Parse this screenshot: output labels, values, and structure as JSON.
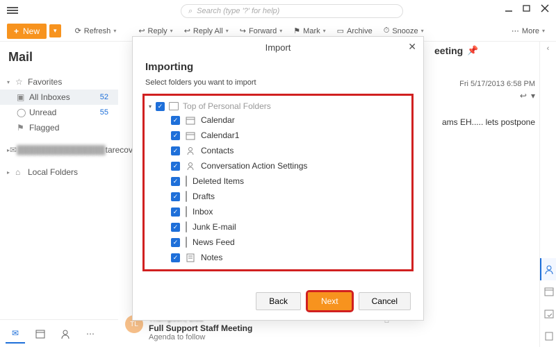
{
  "search": {
    "placeholder": "Search (type '?' for help)"
  },
  "toolbar": {
    "new": "New",
    "refresh": "Refresh",
    "reply": "Reply",
    "reply_all": "Reply All",
    "forward": "Forward",
    "mark": "Mark",
    "archive": "Archive",
    "snooze": "Snooze",
    "more": "More"
  },
  "sidebar": {
    "title": "Mail",
    "favorites": "Favorites",
    "items": [
      {
        "label": "All Inboxes",
        "count": "52"
      },
      {
        "label": "Unread",
        "count": "55"
      },
      {
        "label": "Flagged",
        "count": ""
      }
    ],
    "account_blur": "tarecovery",
    "local": "Local Folders"
  },
  "list": {
    "avatar_initials": "TL",
    "from": "Thompson, Lisa",
    "subject": "Full Support Staff Meeting",
    "preview": "Agenda to follow"
  },
  "preview": {
    "subject": "eeting",
    "date": "Fri 5/17/2013 6:58 PM",
    "body": "ams EH..... lets postpone"
  },
  "dialog": {
    "title": "Import",
    "heading": "Importing",
    "subheading": "Select folders you want to import",
    "root": "Top of Personal Folders",
    "folders": [
      {
        "label": "Calendar",
        "icon": "cal"
      },
      {
        "label": "Calendar1",
        "icon": "cal"
      },
      {
        "label": "Contacts",
        "icon": "contact"
      },
      {
        "label": "Conversation Action Settings",
        "icon": "contact"
      },
      {
        "label": "Deleted Items",
        "icon": "folder"
      },
      {
        "label": "Drafts",
        "icon": "folder"
      },
      {
        "label": "Inbox",
        "icon": "folder"
      },
      {
        "label": "Junk E-mail",
        "icon": "folder"
      },
      {
        "label": "News Feed",
        "icon": "folder"
      },
      {
        "label": "Notes",
        "icon": "note"
      }
    ],
    "buttons": {
      "back": "Back",
      "next": "Next",
      "cancel": "Cancel"
    }
  }
}
